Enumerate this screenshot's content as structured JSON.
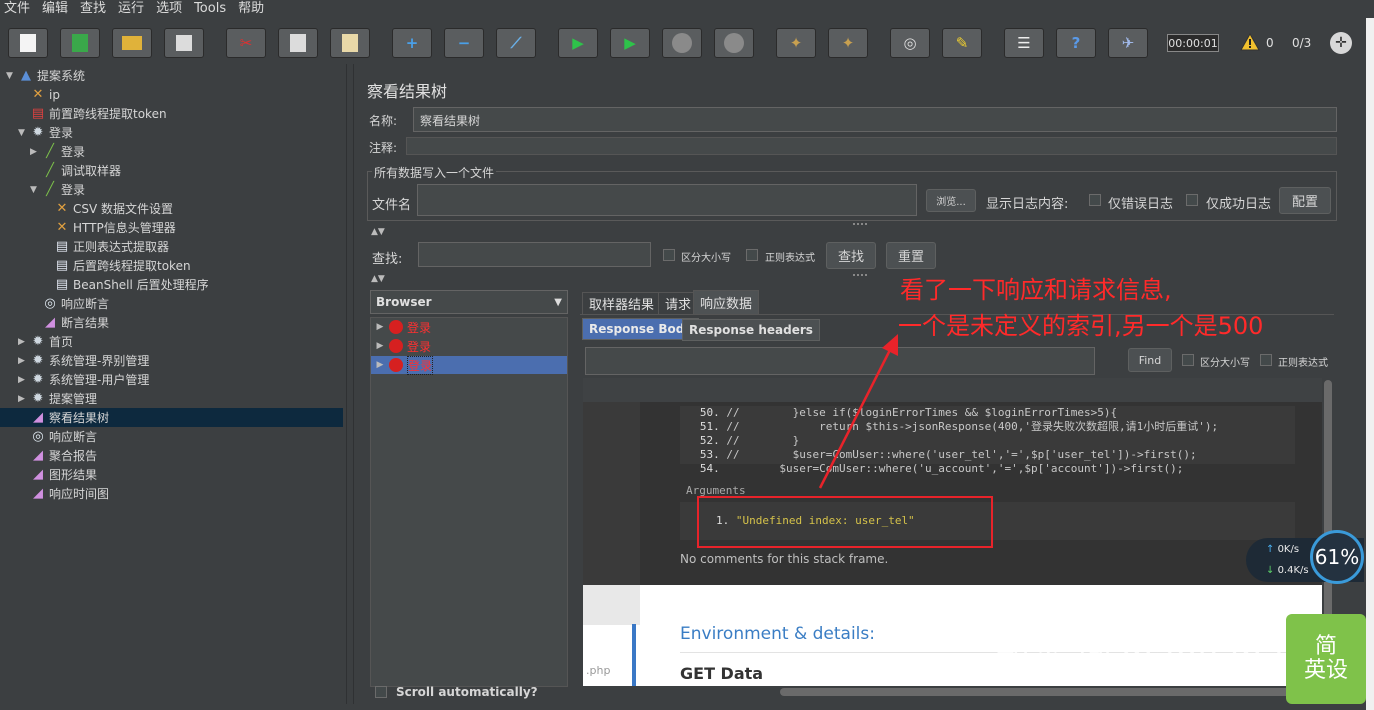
{
  "menubar": [
    "文件",
    "编辑",
    "查找",
    "运行",
    "选项",
    "Tools",
    "帮助"
  ],
  "toolbar": {
    "timer": "00:00:01",
    "warnings": "0",
    "threads": "0/3"
  },
  "tree": [
    {
      "label": "提案系统",
      "icon": "testplan-icon",
      "level": 0,
      "expand": "▼"
    },
    {
      "label": "ip",
      "icon": "config-icon",
      "level": 1,
      "expand": ""
    },
    {
      "label": "前置跨线程提取token",
      "icon": "script-icon",
      "level": 1,
      "expand": ""
    },
    {
      "label": "登录",
      "icon": "gear-icon",
      "level": 1,
      "expand": "▼"
    },
    {
      "label": "登录",
      "icon": "sampler-icon",
      "level": 2,
      "expand": "▶"
    },
    {
      "label": "调试取样器",
      "icon": "sampler-icon",
      "level": 2,
      "expand": ""
    },
    {
      "label": "登录",
      "icon": "sampler-icon",
      "level": 2,
      "expand": "▼"
    },
    {
      "label": "CSV 数据文件设置",
      "icon": "config-icon",
      "level": 3,
      "expand": ""
    },
    {
      "label": "HTTP信息头管理器",
      "icon": "config-icon",
      "level": 3,
      "expand": ""
    },
    {
      "label": "正则表达式提取器",
      "icon": "doc-icon",
      "level": 3,
      "expand": ""
    },
    {
      "label": "后置跨线程提取token",
      "icon": "doc-icon",
      "level": 3,
      "expand": ""
    },
    {
      "label": "BeanShell 后置处理程序",
      "icon": "doc-icon",
      "level": 3,
      "expand": ""
    },
    {
      "label": "响应断言",
      "icon": "magnifier-icon",
      "level": 2,
      "expand": ""
    },
    {
      "label": "断言结果",
      "icon": "chart-icon",
      "level": 2,
      "expand": ""
    },
    {
      "label": "首页",
      "icon": "gear-icon",
      "level": 1,
      "expand": "▶"
    },
    {
      "label": "系统管理-界别管理",
      "icon": "gear-icon",
      "level": 1,
      "expand": "▶"
    },
    {
      "label": "系统管理-用户管理",
      "icon": "gear-icon",
      "level": 1,
      "expand": "▶"
    },
    {
      "label": "提案管理",
      "icon": "gear-icon",
      "level": 1,
      "expand": "▶"
    },
    {
      "label": "察看结果树",
      "icon": "chart-icon",
      "level": 1,
      "expand": "",
      "selected": true
    },
    {
      "label": "响应断言",
      "icon": "magnifier-icon",
      "level": 1,
      "expand": ""
    },
    {
      "label": "聚合报告",
      "icon": "chart-icon",
      "level": 1,
      "expand": ""
    },
    {
      "label": "图形结果",
      "icon": "chart-icon",
      "level": 1,
      "expand": ""
    },
    {
      "label": "响应时间图",
      "icon": "chart-icon",
      "level": 1,
      "expand": ""
    }
  ],
  "panel": {
    "title": "察看结果树",
    "name_label": "名称:",
    "name_value": "察看结果树",
    "comment_label": "注释:",
    "file_section": "所有数据写入一个文件",
    "file_label": "文件名",
    "browse": "浏览...",
    "log_label": "显示日志内容:",
    "errors_only": "仅错误日志",
    "success_only": "仅成功日志",
    "configure": "配置",
    "search_label": "查找:",
    "case_sensitive": "区分大小写",
    "regex": "正则表达式",
    "search_btn": "查找",
    "reset_btn": "重置",
    "renderer": "Browser",
    "scroll_auto": "Scroll automatically?",
    "results": [
      "登录",
      "登录",
      "登录"
    ],
    "tabs": [
      "取样器结果",
      "请求",
      "响应数据"
    ],
    "subtabs": [
      "Response Body",
      "Response headers"
    ],
    "find_btn": "Find",
    "find_case": "区分大小写",
    "find_regex": "正则表达式"
  },
  "code": {
    "lines": [
      {
        "num": "50.",
        "text": "//        }else if($loginErrorTimes && $loginErrorTimes>5){"
      },
      {
        "num": "51.",
        "text": "//            return $this->jsonResponse(400,'登录失败次数超限,请1小时后重试');"
      },
      {
        "num": "52.",
        "text": "//        }"
      },
      {
        "num": "53.",
        "text": "//        $user=ComUser::where('user_tel','=',$p['user_tel'])->first();"
      },
      {
        "num": "54.",
        "text": "        $user=ComUser::where('u_account','=',$p['account'])->first();"
      }
    ],
    "args_label": "Arguments",
    "arg_num": "1.",
    "arg_value": "\"Undefined index: user_tel\"",
    "no_comments": "No comments for this stack frame.",
    "env_title": "Environment & details:",
    "get_data": "GET Data",
    "php_label": ".php"
  },
  "annotation": {
    "line1": "看了一下响应和请求信息,",
    "line2": "一个是未定义的索引,另一个是500"
  },
  "network": {
    "percent": "61%",
    "up": "0K/s",
    "down": "0.4K/s"
  },
  "watermark": "知乎 @zhaoyanan",
  "ime": [
    "简",
    "英设"
  ]
}
